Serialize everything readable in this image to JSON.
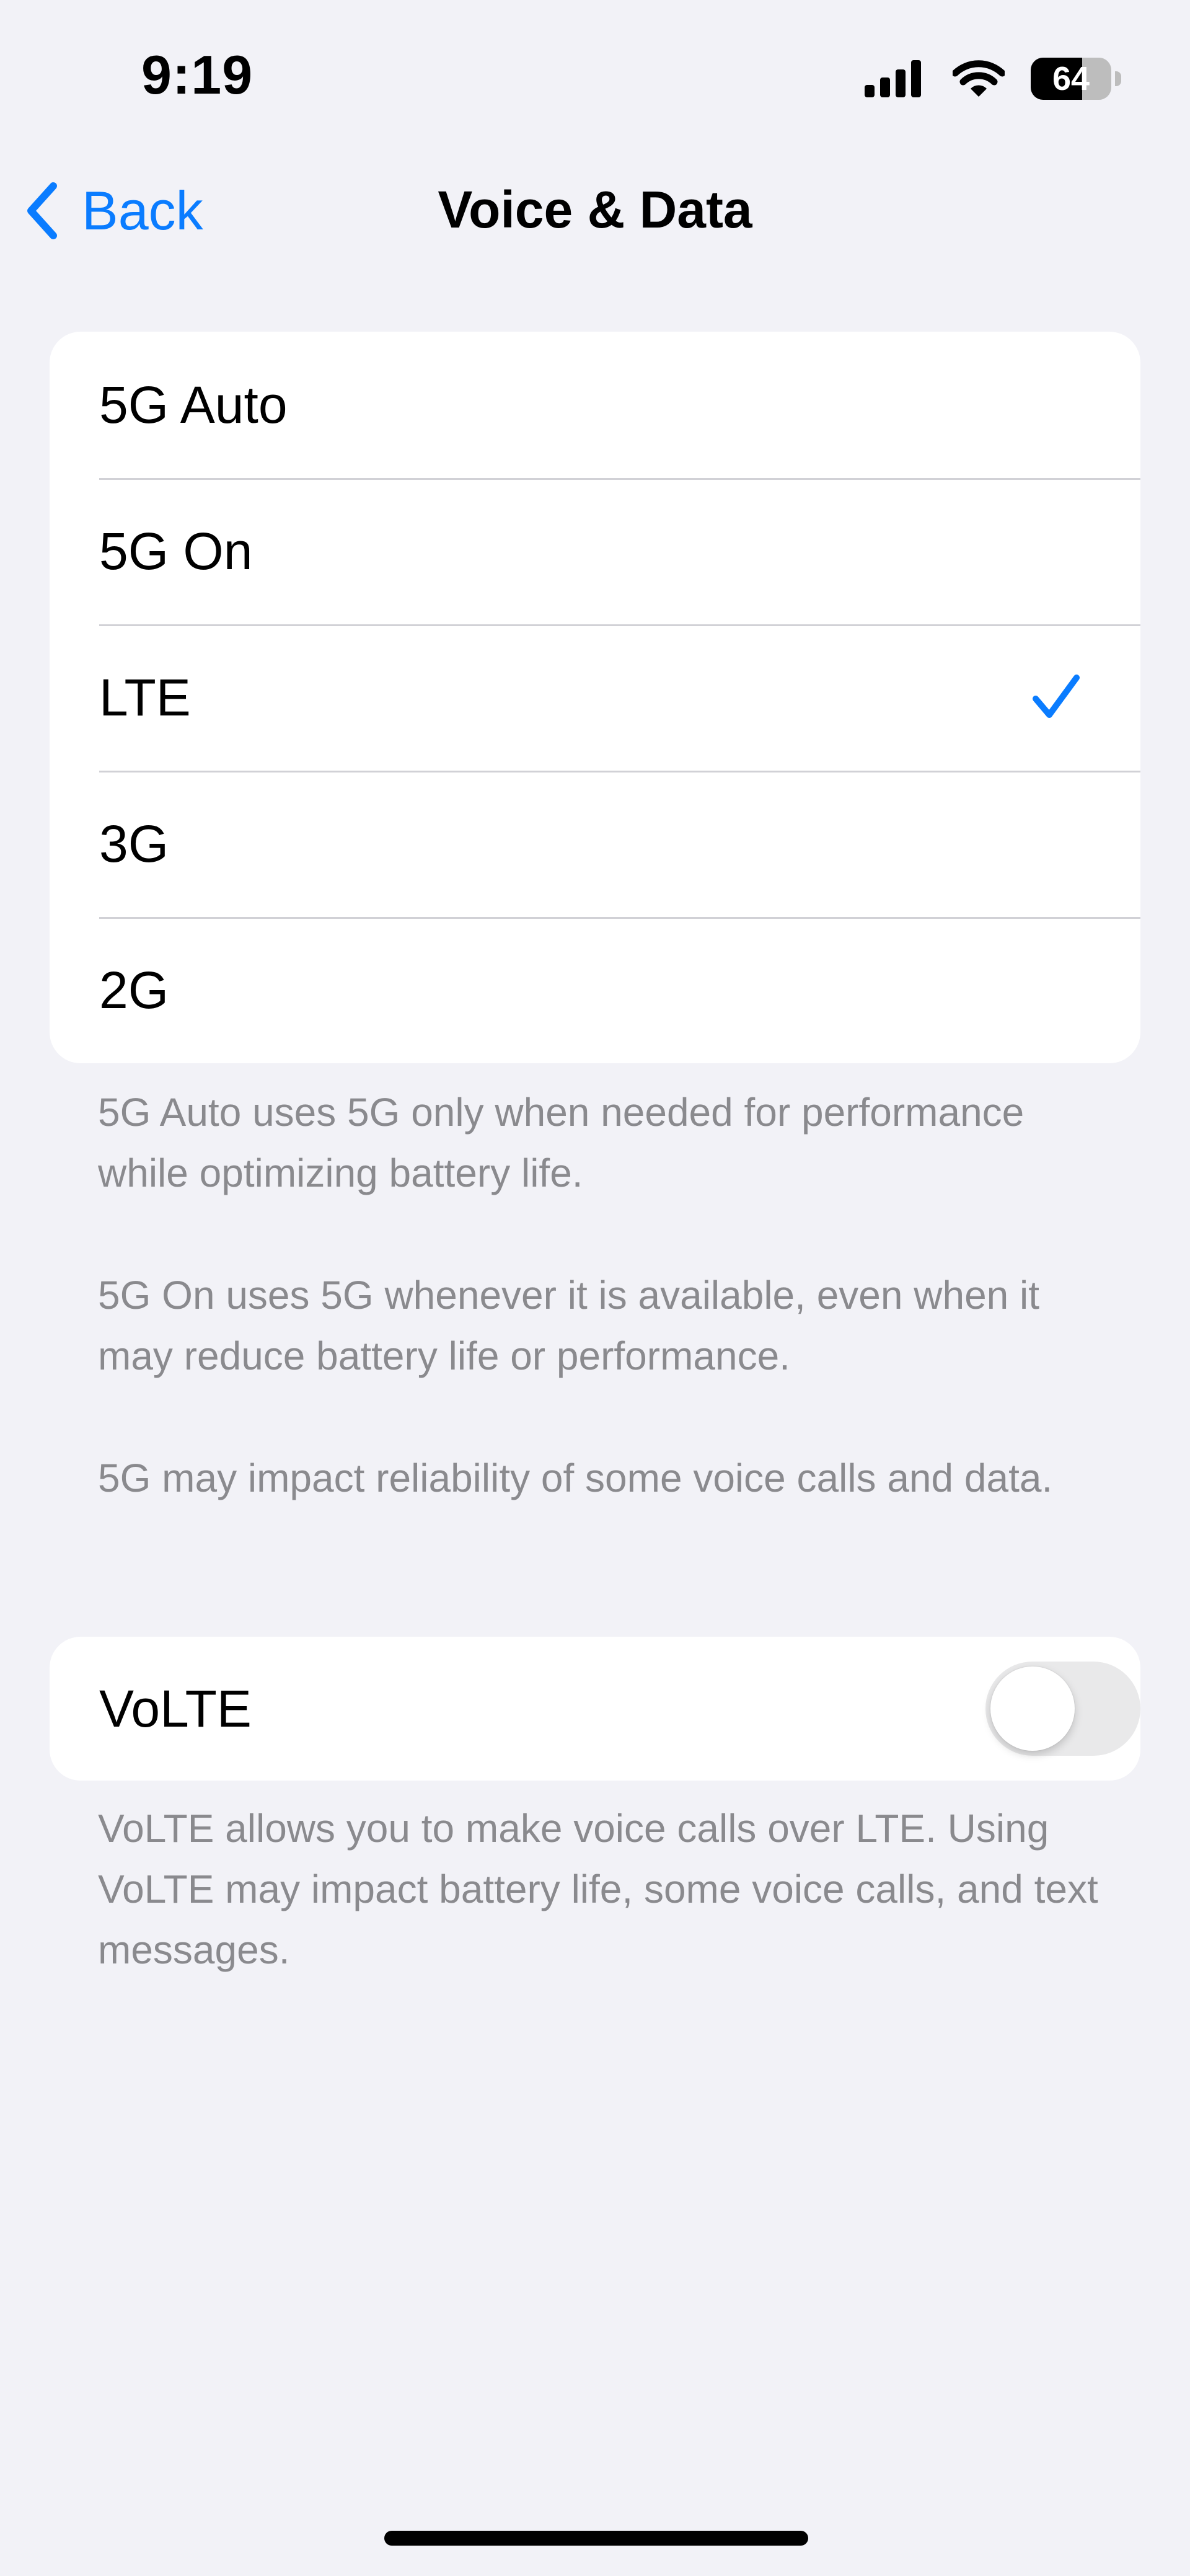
{
  "status_bar": {
    "time": "9:19",
    "battery": "64",
    "battery_level_percent": 64,
    "signal_icon": "cellular-signal-icon",
    "wifi_icon": "wifi-icon",
    "battery_icon": "battery-icon"
  },
  "nav": {
    "back_label": "Back",
    "back_icon": "chevron-left-icon",
    "title": "Voice & Data"
  },
  "options": [
    {
      "label": "5G Auto",
      "selected": false
    },
    {
      "label": "5G On",
      "selected": false
    },
    {
      "label": "LTE",
      "selected": true
    },
    {
      "label": "3G",
      "selected": false
    },
    {
      "label": "2G",
      "selected": false
    }
  ],
  "footers": [
    "5G Auto uses 5G only when needed for performance while optimizing battery life.",
    "5G On uses 5G whenever it is available, even when it may reduce battery life or performance.",
    "5G may impact reliability of some voice calls and data."
  ],
  "volte": {
    "label": "VoLTE",
    "enabled": false,
    "footer": "VoLTE allows you to make voice calls over LTE. Using VoLTE may impact battery life, some voice calls, and text messages."
  },
  "colors": {
    "accent": "#0a7cff",
    "background": "#f2f2f7",
    "secondary_text": "#8a8a8e"
  }
}
